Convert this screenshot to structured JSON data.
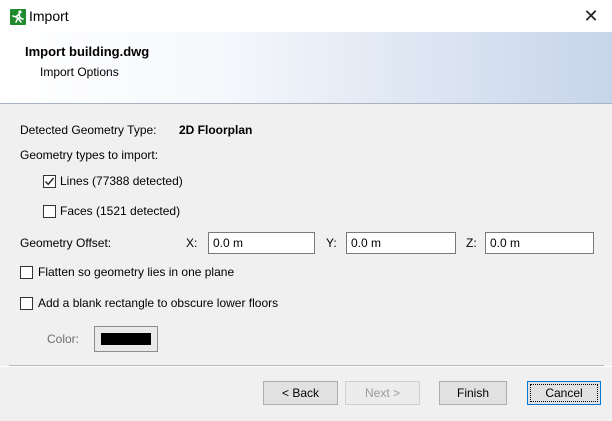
{
  "window": {
    "title": "Import"
  },
  "header": {
    "title": "Import building.dwg",
    "subtitle": "Import Options"
  },
  "geometry": {
    "detected_label": "Detected Geometry Type:",
    "detected_value": "2D Floorplan",
    "types_label": "Geometry types to import:",
    "lines": {
      "label": "Lines (77388 detected)",
      "checked": true
    },
    "faces": {
      "label": "Faces (1521 detected)",
      "checked": false
    }
  },
  "offset": {
    "label": "Geometry Offset:",
    "x_label": "X:",
    "x_value": "0.0 m",
    "y_label": "Y:",
    "y_value": "0.0 m",
    "z_label": "Z:",
    "z_value": "0.0 m"
  },
  "flatten": {
    "label": "Flatten so geometry lies in one plane",
    "checked": false
  },
  "blank_rect": {
    "label": "Add a blank rectangle to obscure lower floors",
    "checked": false
  },
  "color": {
    "label": "Color:",
    "value": "#000000"
  },
  "buttons": {
    "back": "< Back",
    "next": "Next >",
    "finish": "Finish",
    "cancel": "Cancel"
  }
}
